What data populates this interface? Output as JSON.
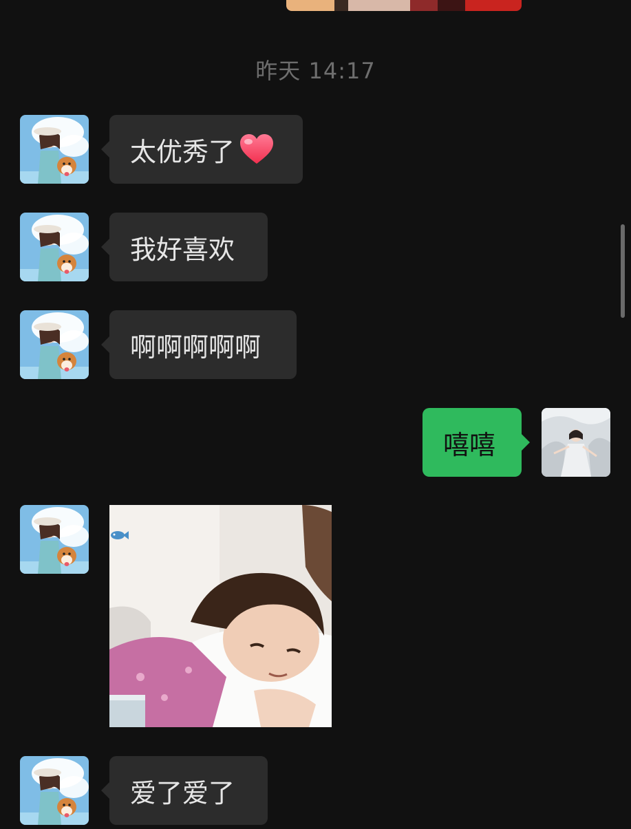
{
  "chat": {
    "timestamp": "昨天 14:17",
    "messages": [
      {
        "sender": "contact",
        "type": "text",
        "text": "太优秀了",
        "emoji": "heart"
      },
      {
        "sender": "contact",
        "type": "text",
        "text": "我好喜欢"
      },
      {
        "sender": "contact",
        "type": "text",
        "text": "啊啊啊啊啊"
      },
      {
        "sender": "me",
        "type": "text",
        "text": "嘻嘻"
      },
      {
        "sender": "contact",
        "type": "image",
        "description": "sticker"
      },
      {
        "sender": "contact",
        "type": "text",
        "text": "爱了爱了"
      }
    ]
  },
  "icons": {
    "heart": "heart-icon",
    "fish": "fish-icon"
  },
  "colors": {
    "background": "#111111",
    "incoming_bubble": "#2c2c2c",
    "outgoing_bubble": "#2fba5d",
    "timestamp_text": "#6e6e6e"
  }
}
